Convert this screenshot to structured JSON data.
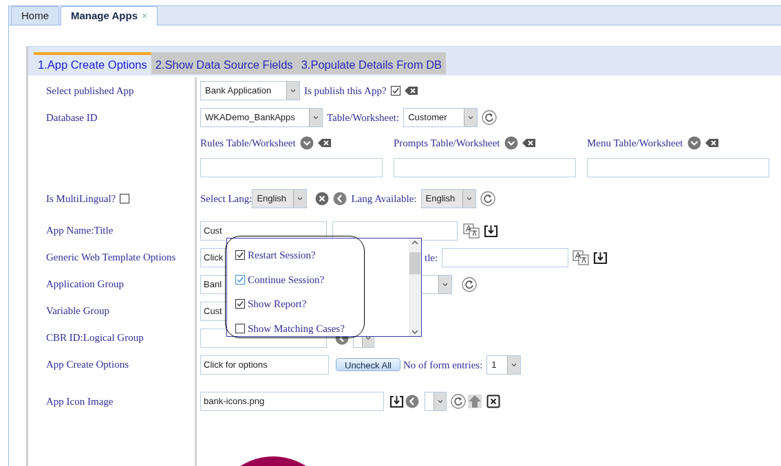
{
  "tabs": [
    {
      "label": "Home",
      "selected": false
    },
    {
      "label": "Manage Apps",
      "selected": true,
      "close": "×"
    }
  ],
  "wizard_steps": [
    {
      "label": "1.App Create Options",
      "selected": true
    },
    {
      "label": "2.Show Data Source Fields",
      "selected": false
    },
    {
      "label": "3.Populate Details From DB",
      "selected": false
    }
  ],
  "form": {
    "select_published_app": {
      "label": "Select published App",
      "value": "Bank Application",
      "publish_label": "Is publish this App?",
      "published": true
    },
    "database_id": {
      "label": "Database ID",
      "value": "WKADemo_BankApps",
      "table_label": "Table/Worksheet:",
      "table_value": "Customer"
    },
    "worksheets": [
      {
        "label": "Rules Table/Worksheet"
      },
      {
        "label": "Prompts Table/Worksheet"
      },
      {
        "label": "Menu Table/Worksheet"
      }
    ],
    "multilingual": {
      "label": "Is MultiLingual?",
      "checked": false,
      "select_lang_label": "Select Lang:",
      "select_lang_value": "English",
      "lang_available_label": "Lang Available:",
      "lang_available_value": "English"
    },
    "app_name": {
      "label": "App Name:Title",
      "value": "Cust"
    },
    "web_template": {
      "label": "Generic Web Template Options",
      "value": "Click",
      "title_label": "tle:"
    },
    "application_group": {
      "label": "Application Group",
      "value": "Banl"
    },
    "variable_group": {
      "label": "Variable Group",
      "value": "Cust"
    },
    "cbr_id": {
      "label": "CBR ID:Logical Group"
    },
    "app_create_options": {
      "label": "App Create Options",
      "value": "Click for options",
      "button": "Uncheck All",
      "entries_label": "No of form entries:",
      "entries_value": "1"
    },
    "app_icon": {
      "label": "App Icon Image",
      "value": "bank-icons.png"
    }
  },
  "options_popup": {
    "items": [
      {
        "label": "Restart Session?",
        "checked": true,
        "focused": false
      },
      {
        "label": "Continue Session?",
        "checked": true,
        "focused": true
      },
      {
        "label": "Show Report?",
        "checked": true,
        "focused": false
      },
      {
        "label": "Show Matching Cases?",
        "checked": false,
        "focused": false
      }
    ]
  }
}
